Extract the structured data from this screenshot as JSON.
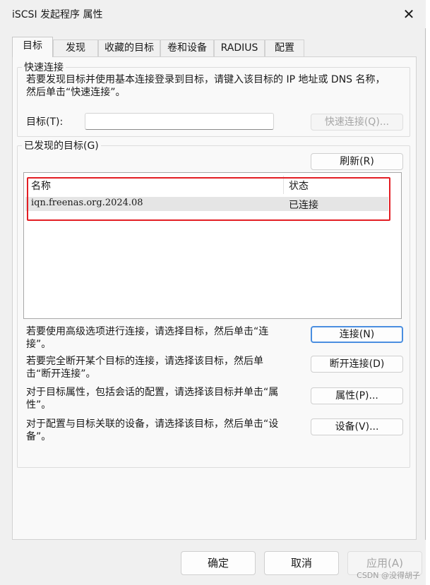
{
  "window": {
    "title": "iSCSI 发起程序 属性",
    "close_glyph": "✕"
  },
  "tabs": [
    {
      "label": "目标"
    },
    {
      "label": "发现"
    },
    {
      "label": "收藏的目标"
    },
    {
      "label": "卷和设备"
    },
    {
      "label": "RADIUS"
    },
    {
      "label": "配置"
    }
  ],
  "quick_connect": {
    "group_label": "快速连接",
    "description": "若要发现目标并使用基本连接登录到目标，请键入该目标的 IP 地址或 DNS 名称，然后单击“快速连接”。",
    "target_label": "目标(T):",
    "target_value": "",
    "button_label": "快速连接(Q)..."
  },
  "discovered": {
    "group_label": "已发现的目标(G)",
    "refresh_label": "刷新(R)",
    "columns": [
      "名称",
      "状态"
    ],
    "rows": [
      {
        "name": "iqn.freenas.org.2024.08",
        "status": "已连接"
      }
    ]
  },
  "actions": [
    {
      "text": "若要使用高级选项进行连接，请选择目标，然后单击“连接”。",
      "button": "连接(N)"
    },
    {
      "text": "若要完全断开某个目标的连接，请选择该目标，然后单击“断开连接”。",
      "button": "断开连接(D)"
    },
    {
      "text": "对于目标属性，包括会话的配置，请选择该目标并单击“属性”。",
      "button": "属性(P)..."
    },
    {
      "text": "对于配置与目标关联的设备，请选择该目标，然后单击“设备”。",
      "button": "设备(V)..."
    }
  ],
  "footer": {
    "ok": "确定",
    "cancel": "取消",
    "apply": "应用(A)"
  },
  "watermark": "CSDN @没得胡子",
  "colors": {
    "highlight_border": "#e31e24",
    "focus_border": "#4a8ee0"
  }
}
